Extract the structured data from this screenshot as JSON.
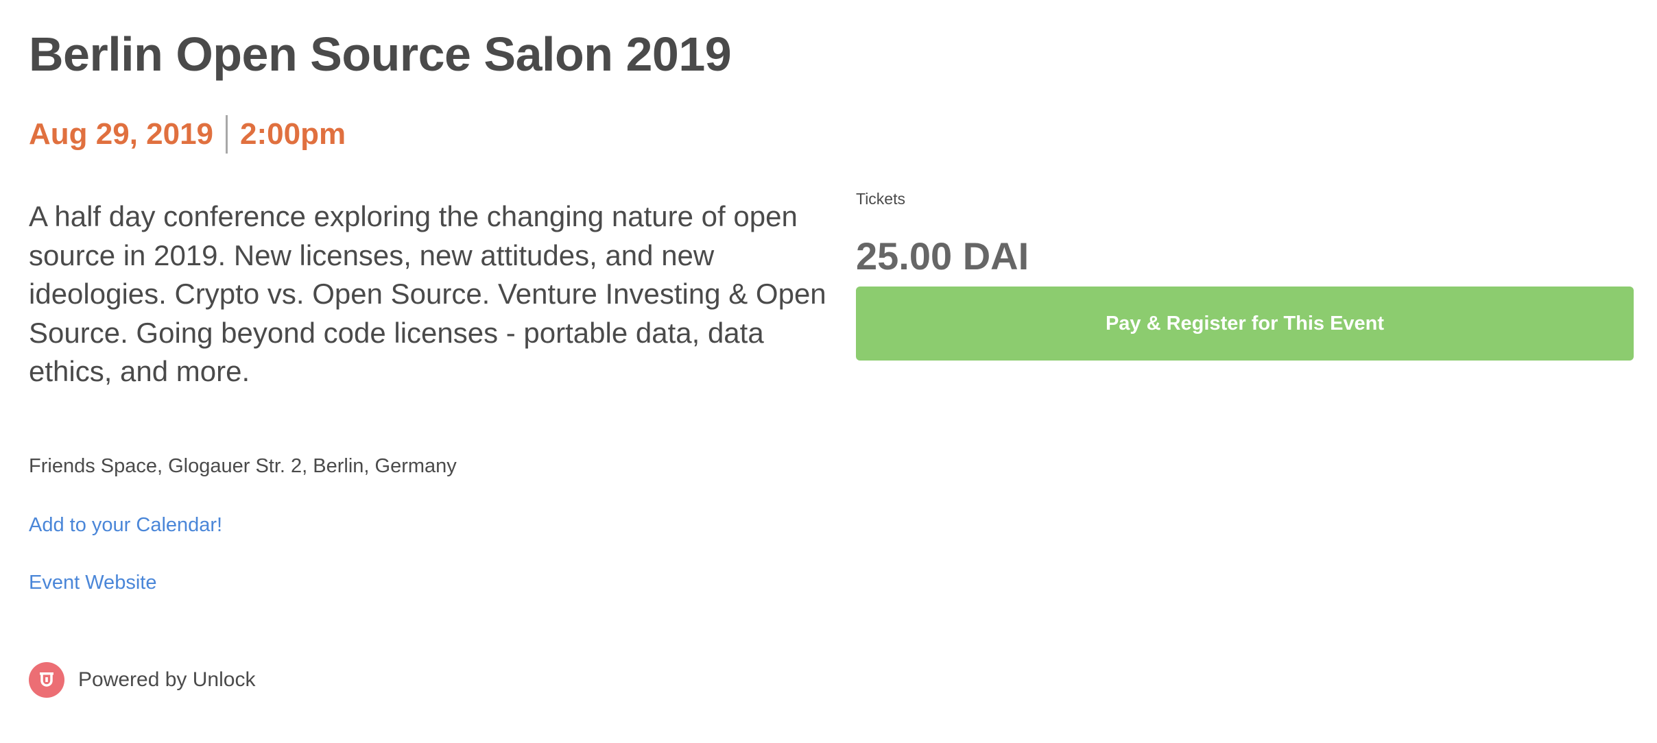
{
  "event": {
    "title": "Berlin Open Source Salon 2019",
    "date": "Aug 29, 2019",
    "time": "2:00pm",
    "description": "A half day conference exploring the changing nature of open source in 2019. New licenses, new attitudes, and new ideologies. Crypto vs. Open Source. Venture Investing & Open Source. Going beyond code licenses - portable data, data ethics, and more.",
    "location": "Friends Space, Glogauer Str. 2, Berlin, Germany"
  },
  "links": {
    "calendar": "Add to your Calendar!",
    "website": "Event Website"
  },
  "tickets": {
    "label": "Tickets",
    "price": "25.00 DAI",
    "button_label": "Pay & Register for This Event"
  },
  "footer": {
    "powered_by": "Powered by Unlock",
    "logo_icon": "unlock-logo-icon"
  },
  "colors": {
    "date_accent": "#e0703f",
    "link": "#4a86d8",
    "button_bg": "#8ccc6f",
    "logo": "#ec6e74",
    "text": "#4a4a4a"
  }
}
